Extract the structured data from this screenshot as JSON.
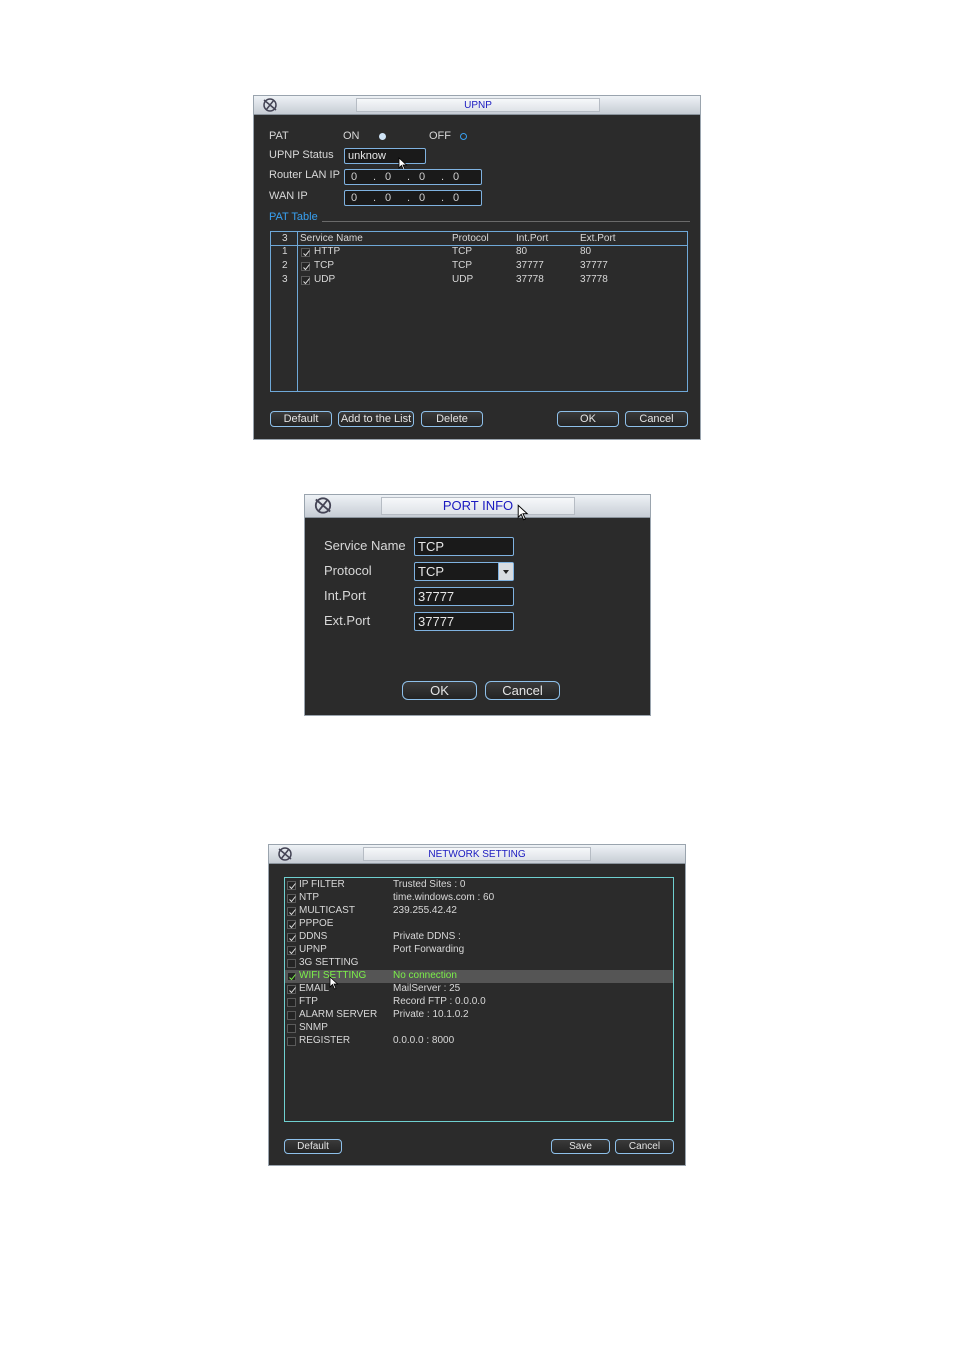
{
  "upnp": {
    "title": "UPNP",
    "pat_label": "PAT",
    "on_label": "ON",
    "off_label": "OFF",
    "status_label": "UPNP Status",
    "status_value": "unknow",
    "router_lan_ip_label": "Router LAN IP",
    "router_lan_ip": [
      "0",
      "0",
      "0",
      "0"
    ],
    "wan_ip_label": "WAN IP",
    "wan_ip": [
      "0",
      "0",
      "0",
      "0"
    ],
    "pat_table_label": "PAT Table",
    "table": {
      "count": "3",
      "headers": [
        "Service Name",
        "Protocol",
        "Int.Port",
        "Ext.Port"
      ],
      "rows": [
        {
          "index": "1",
          "name": "HTTP",
          "protocol": "TCP",
          "int_port": "80",
          "ext_port": "80"
        },
        {
          "index": "2",
          "name": "TCP",
          "protocol": "TCP",
          "int_port": "37777",
          "ext_port": "37777"
        },
        {
          "index": "3",
          "name": "UDP",
          "protocol": "UDP",
          "int_port": "37778",
          "ext_port": "37778"
        }
      ]
    },
    "buttons": {
      "default": "Default",
      "add": "Add to the List",
      "delete": "Delete",
      "ok": "OK",
      "cancel": "Cancel"
    }
  },
  "port_info": {
    "title": "PORT INFO",
    "service_name_label": "Service Name",
    "service_name": "TCP",
    "protocol_label": "Protocol",
    "protocol": "TCP",
    "int_port_label": "Int.Port",
    "int_port": "37777",
    "ext_port_label": "Ext.Port",
    "ext_port": "37777",
    "buttons": {
      "ok": "OK",
      "cancel": "Cancel"
    }
  },
  "network_setting": {
    "title": "NETWORK SETTING",
    "items": [
      {
        "name": "IP FILTER",
        "value": "Trusted Sites : 0",
        "checked": true
      },
      {
        "name": "NTP",
        "value": "time.windows.com : 60",
        "checked": true
      },
      {
        "name": "MULTICAST",
        "value": "239.255.42.42",
        "checked": true
      },
      {
        "name": "PPPOE",
        "value": "",
        "checked": true
      },
      {
        "name": "DDNS",
        "value": "Private DDNS :",
        "checked": true
      },
      {
        "name": "UPNP",
        "value": "Port Forwarding",
        "checked": true
      },
      {
        "name": "3G SETTING",
        "value": "",
        "checked": false
      },
      {
        "name": "WIFI SETTING",
        "value": "No connection",
        "checked": true,
        "selected": true
      },
      {
        "name": "EMAIL",
        "value": "MailServer : 25",
        "checked": true
      },
      {
        "name": "FTP",
        "value": "Record FTP : 0.0.0.0",
        "checked": false
      },
      {
        "name": "ALARM SERVER",
        "value": "Private : 10.1.0.2",
        "checked": false
      },
      {
        "name": "SNMP",
        "value": "",
        "checked": false
      },
      {
        "name": "REGISTER",
        "value": "0.0.0.0 : 8000",
        "checked": false
      }
    ],
    "buttons": {
      "default": "Default",
      "save": "Save",
      "cancel": "Cancel"
    }
  },
  "colors": {
    "accent": "#38a0f0",
    "selected_text": "#7cf04a",
    "panel_bg": "#2b2b2b"
  }
}
